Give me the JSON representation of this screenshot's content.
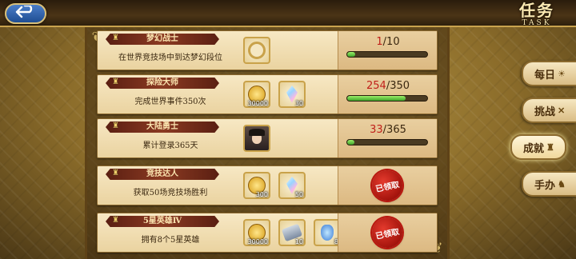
{
  "header": {
    "title": "任务",
    "title_en": "TASK"
  },
  "icons": {
    "back": "back-arrow-icon",
    "trophy": "trophy-icon"
  },
  "tasks": [
    {
      "name": "梦幻战士",
      "desc": "在世界竞技场中到达梦幻段位",
      "rewards": [
        {
          "icon": "frame-icon",
          "count": ""
        }
      ],
      "status": "progress",
      "current": "1",
      "total": "/10",
      "progress": 0.1
    },
    {
      "name": "探险大师",
      "desc": "完成世界事件350次",
      "rewards": [
        {
          "icon": "gold-coin-icon",
          "count": "30000"
        },
        {
          "icon": "rainbow-crystal-icon",
          "count": "30"
        }
      ],
      "status": "progress",
      "current": "254",
      "total": "/350",
      "progress": 0.726
    },
    {
      "name": "大陆勇士",
      "desc": "累计登录365天",
      "rewards": [
        {
          "icon": "hero-portrait-icon",
          "count": ""
        }
      ],
      "status": "progress",
      "current": "33",
      "total": "/365",
      "progress": 0.09
    },
    {
      "name": "竞技达人",
      "desc": "获取50场竞技场胜利",
      "rewards": [
        {
          "icon": "gold-coin-icon",
          "count": "300"
        },
        {
          "icon": "rainbow-crystal-icon",
          "count": "50"
        }
      ],
      "status": "claimed",
      "claimed_label": "已领取"
    },
    {
      "name": "5星英雄Ⅳ",
      "desc": "拥有8个5星英雄",
      "rewards": [
        {
          "icon": "gold-coin-icon",
          "count": "30000"
        },
        {
          "icon": "scroll-icon",
          "count": "10"
        },
        {
          "icon": "potion-icon",
          "count": "8"
        }
      ],
      "status": "claimed",
      "claimed_label": "已领取"
    }
  ],
  "side_tabs": [
    {
      "label": "每日",
      "icon": "sun-icon",
      "active": false
    },
    {
      "label": "挑战",
      "icon": "crossed-swords-icon",
      "active": false
    },
    {
      "label": "成就",
      "icon": "trophy-icon",
      "active": true
    },
    {
      "label": "手办",
      "icon": "figure-icon",
      "active": false
    }
  ],
  "colors": {
    "accent_gold": "#c9a34e",
    "progress_green": "#3ea42a",
    "current_red": "#c0201a",
    "seal_red": "#a5140d"
  }
}
